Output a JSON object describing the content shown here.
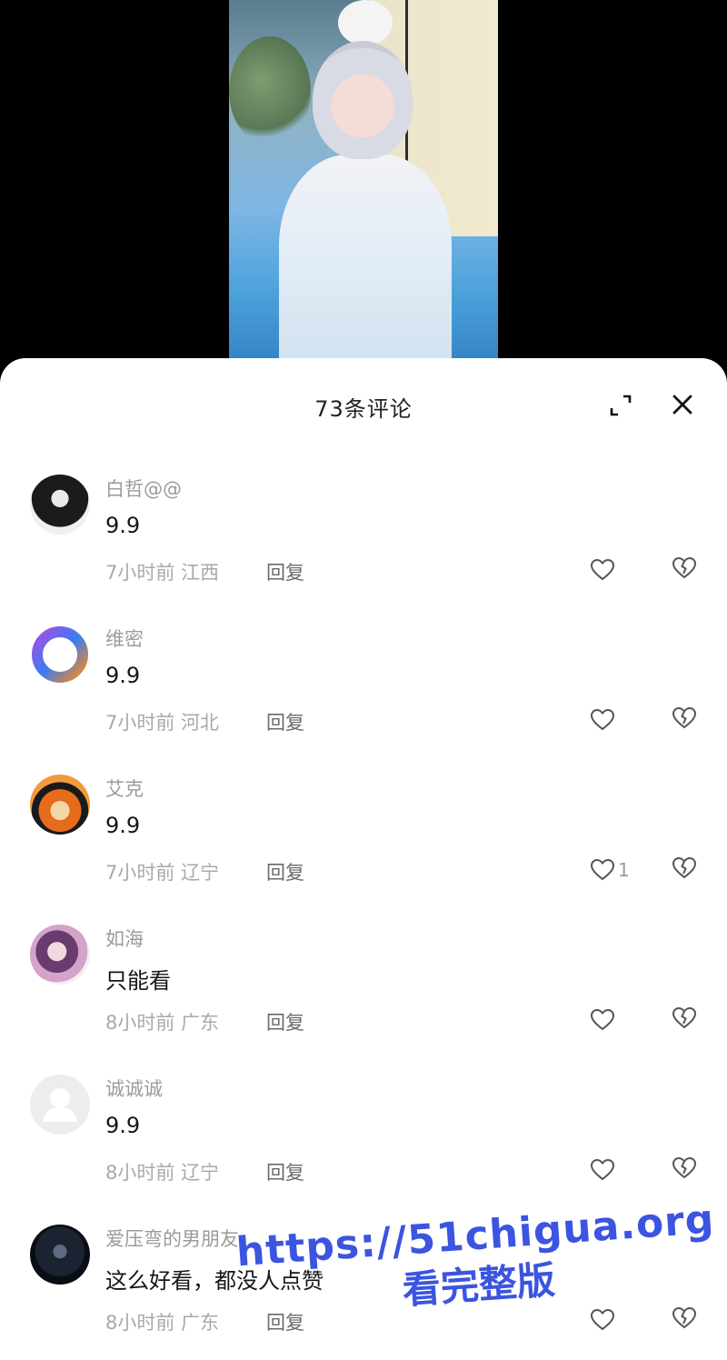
{
  "sheet": {
    "title": "73条评论",
    "expand_icon": "expand-icon",
    "close_icon": "close-icon"
  },
  "comments": [
    {
      "user": "白哲@@",
      "text": "9.9",
      "meta": "7小时前 江西",
      "reply": "回复",
      "likes": "",
      "avatar": "av-dark"
    },
    {
      "user": "维密",
      "text": "9.9",
      "meta": "7小时前 河北",
      "reply": "回复",
      "likes": "",
      "avatar": "av-ring"
    },
    {
      "user": "艾克",
      "text": "9.9",
      "meta": "7小时前 辽宁",
      "reply": "回复",
      "likes": "1",
      "avatar": "av-goku"
    },
    {
      "user": "如海",
      "text": "只能看",
      "meta": "8小时前 广东",
      "reply": "回复",
      "likes": "",
      "avatar": "av-anime"
    },
    {
      "user": "诚诚诚",
      "text": "9.9",
      "meta": "8小时前 辽宁",
      "reply": "回复",
      "likes": "",
      "avatar": "av-default"
    },
    {
      "user": "爱压弯的男朋友",
      "text": "这么好看，都没人点赞",
      "meta": "8小时前 广东",
      "reply": "回复",
      "likes": "",
      "avatar": "av-space"
    }
  ],
  "watermark": {
    "url": "https://51chigua.org",
    "sub": "看完整版"
  },
  "colors": {
    "watermark": "#3b55e0",
    "username": "#9b9b9b",
    "text": "#161616"
  }
}
